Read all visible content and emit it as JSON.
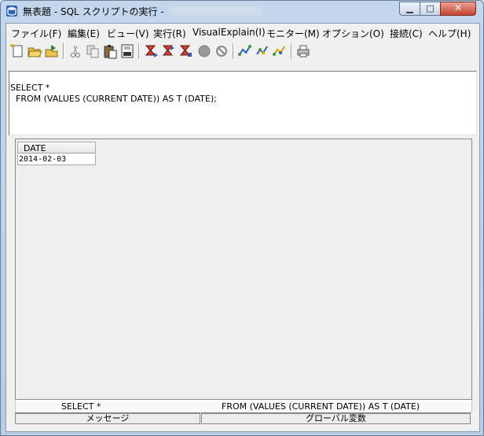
{
  "window": {
    "title": "無表題 - SQL スクリプトの実行 -",
    "minimize_glyph": "▁",
    "maximize_glyph": "□",
    "close_glyph": "✕"
  },
  "menu": [
    "ファイル(F)",
    "編集(E)",
    "ビュー(V)",
    "実行(R)",
    "VisualExplain(I)",
    "モニター(M)",
    "オプション(O)",
    "接続(C)",
    "ヘルプ(H)"
  ],
  "editor": {
    "line1": "SELECT *",
    "line2": "  FROM (VALUES (CURRENT DATE)) AS T (DATE);"
  },
  "results": {
    "column_header": "DATE",
    "cell_value": "2014-02-03"
  },
  "results_tab": {
    "part1": "SELECT *",
    "part2": "FROM (VALUES (CURRENT DATE)) AS T (DATE)"
  },
  "bottom_tabs": {
    "messages": "メッセージ",
    "global_variables": "グローバル変数"
  },
  "icons": [
    "new-file-icon",
    "open-folder-icon",
    "save-icon",
    "cut-icon",
    "copy-icon",
    "paste-icon",
    "sql-icon",
    "run-all-icon",
    "run-from-cursor-icon",
    "run-selected-icon",
    "stop-icon",
    "cancel-icon",
    "explain-icon",
    "explain-current-icon",
    "explain-selected-icon",
    "print-icon"
  ]
}
